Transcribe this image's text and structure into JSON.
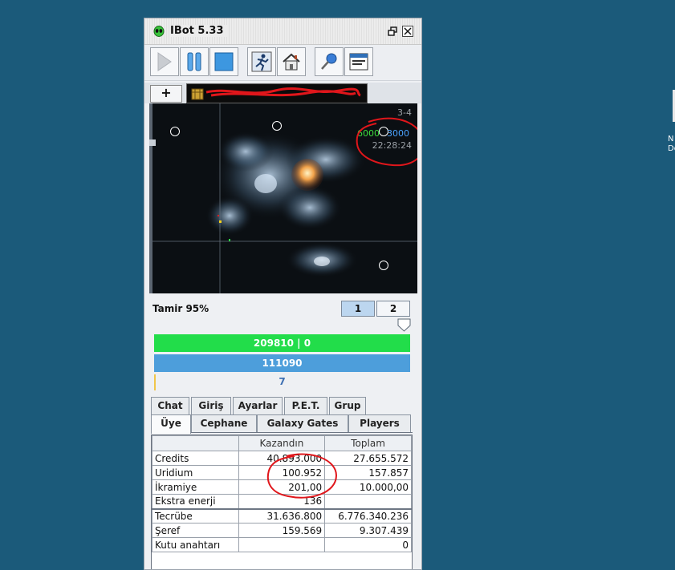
{
  "window": {
    "title": "IBot 5.33"
  },
  "toolbar": {
    "buttons": [
      {
        "name": "play",
        "icon": "play-icon"
      },
      {
        "name": "pause",
        "icon": "pause-icon"
      },
      {
        "name": "stop",
        "icon": "stop-icon"
      },
      {
        "name": "run",
        "icon": "running-man-icon"
      },
      {
        "name": "home",
        "icon": "home-icon"
      },
      {
        "name": "pin",
        "icon": "pin-icon"
      },
      {
        "name": "window",
        "icon": "window-icon"
      }
    ]
  },
  "tabs_top": {
    "add_label": "+"
  },
  "map": {
    "sector": "3-4",
    "stat_green": "6000",
    "stat_blue": "3000",
    "time": "22:28:24",
    "colors": {
      "green": "#3ddc3d",
      "blue": "#4aa3ff",
      "gray": "#9aa0a6"
    }
  },
  "status": {
    "repair": "Tamir 95%",
    "pages": [
      "1",
      "2"
    ],
    "hp_bar": "209810 | 0",
    "shield_bar": "111090",
    "count": "7",
    "colors": {
      "hp": "#22dd4a",
      "shield": "#4d9edb"
    }
  },
  "tabs_row1": [
    "Chat",
    "Giriş",
    "Ayarlar",
    "P.E.T.",
    "Grup"
  ],
  "tabs_row2": [
    "Üye",
    "Cephane",
    "Galaxy Gates",
    "Players"
  ],
  "stats_table": {
    "headers": [
      "",
      "Kazandın",
      "Toplam"
    ],
    "rows": [
      [
        "Credits",
        "40.893.000",
        "27.655.572"
      ],
      [
        "Uridium",
        "100.952",
        "157.857"
      ],
      [
        "İkramiye",
        "201,00",
        "10.000,00"
      ],
      [
        "Ekstra enerji",
        "136",
        ""
      ],
      [
        "Tecrübe",
        "31.636.800",
        "6.776.340.236"
      ],
      [
        "Şeref",
        "159.569",
        "9.307.439"
      ],
      [
        "Kutu anahtarı",
        "",
        "0"
      ]
    ]
  },
  "desktop": {
    "label_lines": [
      "N",
      "Do"
    ]
  }
}
